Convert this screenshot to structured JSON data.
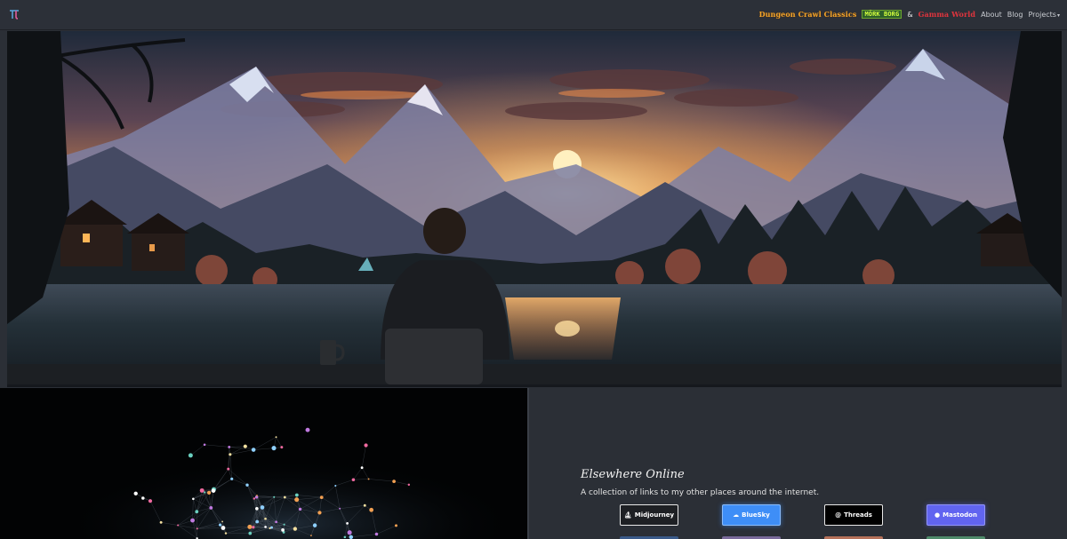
{
  "navbar": {
    "brand_icon": "tau-logo-icon",
    "games": {
      "dungeon_crawl_classics": "Dungeon Crawl Classics",
      "mork_borg": "MÖRK BORG",
      "ampersand": "&",
      "gamma_world": "Gamma World"
    },
    "links": {
      "about": "About",
      "blog": "Blog",
      "projects": "Projects"
    }
  },
  "hero": {
    "image": "illustration of a man seated at a lakeside table watching a sunset over mountains"
  },
  "elsewhere": {
    "title": "Elsewhere Online",
    "subtitle": "A collection of links to my other places around the internet.",
    "buttons": [
      {
        "label": "Midjourney",
        "icon": "sail-icon"
      },
      {
        "label": "BlueSky",
        "icon": "cloud-icon"
      },
      {
        "label": "Threads",
        "icon": "threads-icon"
      },
      {
        "label": "Mastodon",
        "icon": "mastodon-icon"
      }
    ]
  },
  "colors": {
    "navbar_bg": "#2c3038",
    "page_bg": "#2b2f36",
    "bluesky": "#3e8ef7",
    "mastodon": "#6164f0",
    "dcc_orange": "#f2a52b",
    "gamma_red": "#e0343d"
  }
}
